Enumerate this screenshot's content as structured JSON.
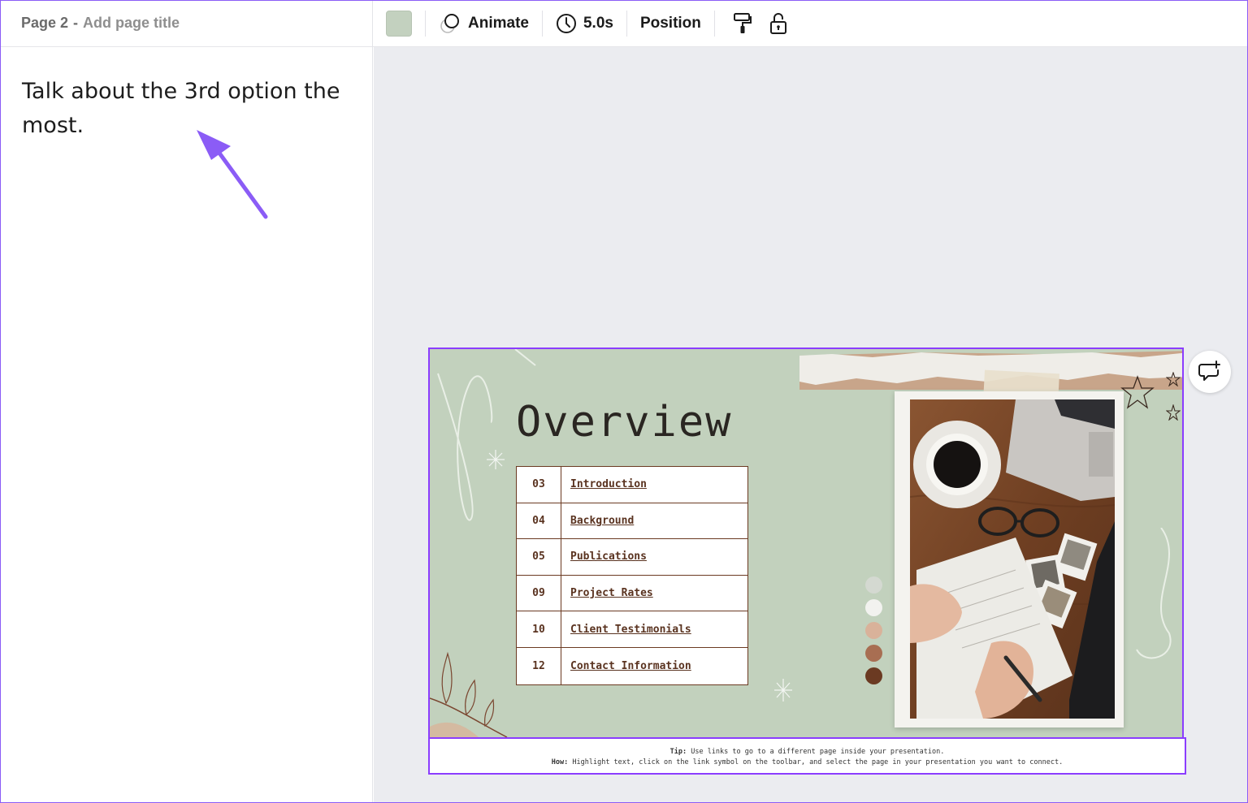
{
  "left_panel": {
    "page_label": "Page 2",
    "separator": "-",
    "title_placeholder": "Add page title",
    "notes_text": "Talk about the 3rd option the most."
  },
  "toolbar": {
    "color_swatch": "#c3d1bf",
    "animate_label": "Animate",
    "duration_label": "5.0s",
    "position_label": "Position",
    "icons": [
      "color-swatch",
      "animate-icon",
      "clock-icon",
      "paint-roller-icon",
      "unlock-icon"
    ]
  },
  "slide": {
    "title": "Overview",
    "toc": [
      {
        "num": "03",
        "label": "Introduction"
      },
      {
        "num": "04",
        "label": "Background"
      },
      {
        "num": "05",
        "label": "Publications"
      },
      {
        "num": "09",
        "label": "Project Rates"
      },
      {
        "num": "10",
        "label": "Client Testimonials"
      },
      {
        "num": "12",
        "label": "Contact Information"
      }
    ],
    "palette": [
      "#d4d9d1",
      "#f2f2ef",
      "#d9b29a",
      "#a86e52",
      "#6b3a22"
    ],
    "background": "#c2d1bd"
  },
  "tip": {
    "tip_label": "Tip:",
    "tip_text": "Use links to go to a different page inside your presentation.",
    "how_label": "How:",
    "how_text": "Highlight text, click on the link symbol on the toolbar, and select the page in your presentation  you want to connect."
  },
  "accent_color": "#8b3dff"
}
